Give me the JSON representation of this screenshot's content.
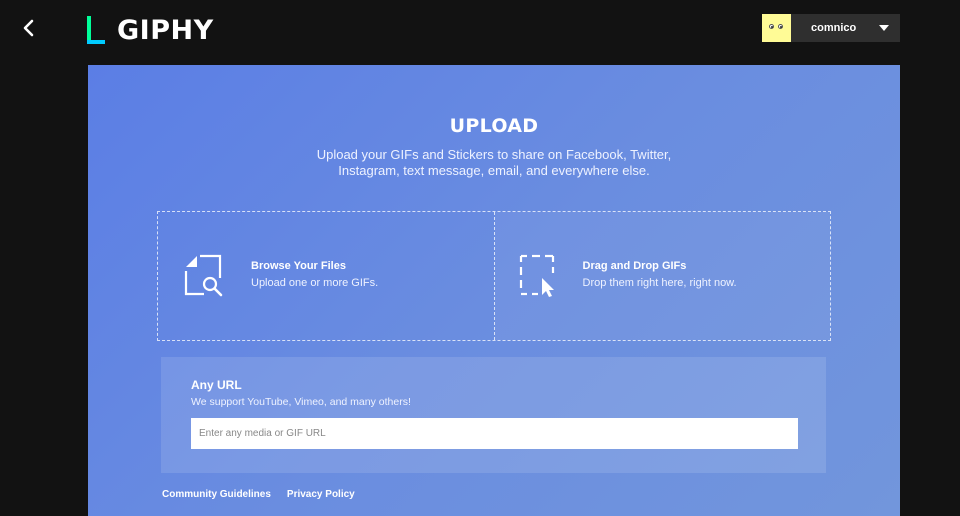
{
  "header": {
    "logo_text": "GIPHY",
    "username": "comnico",
    "accent_colors": [
      "#00ff99",
      "#00ccff",
      "#9933ff"
    ]
  },
  "upload": {
    "title": "UPLOAD",
    "subtitle": "Upload your GIFs and Stickers to share on Facebook, Twitter, Instagram, text message, email, and everywhere else."
  },
  "browse": {
    "title": "Browse Your Files",
    "description": "Upload one or more GIFs.",
    "icon": "file-search-icon"
  },
  "drag_drop": {
    "title": "Drag and Drop GIFs",
    "description": "Drop them right here, right now.",
    "icon": "drop-target-icon"
  },
  "any_url": {
    "title": "Any URL",
    "description": "We support YouTube, Vimeo, and many others!",
    "placeholder": "Enter any media or GIF URL"
  },
  "footer": {
    "community_guidelines": "Community Guidelines",
    "privacy_policy": "Privacy Policy"
  }
}
